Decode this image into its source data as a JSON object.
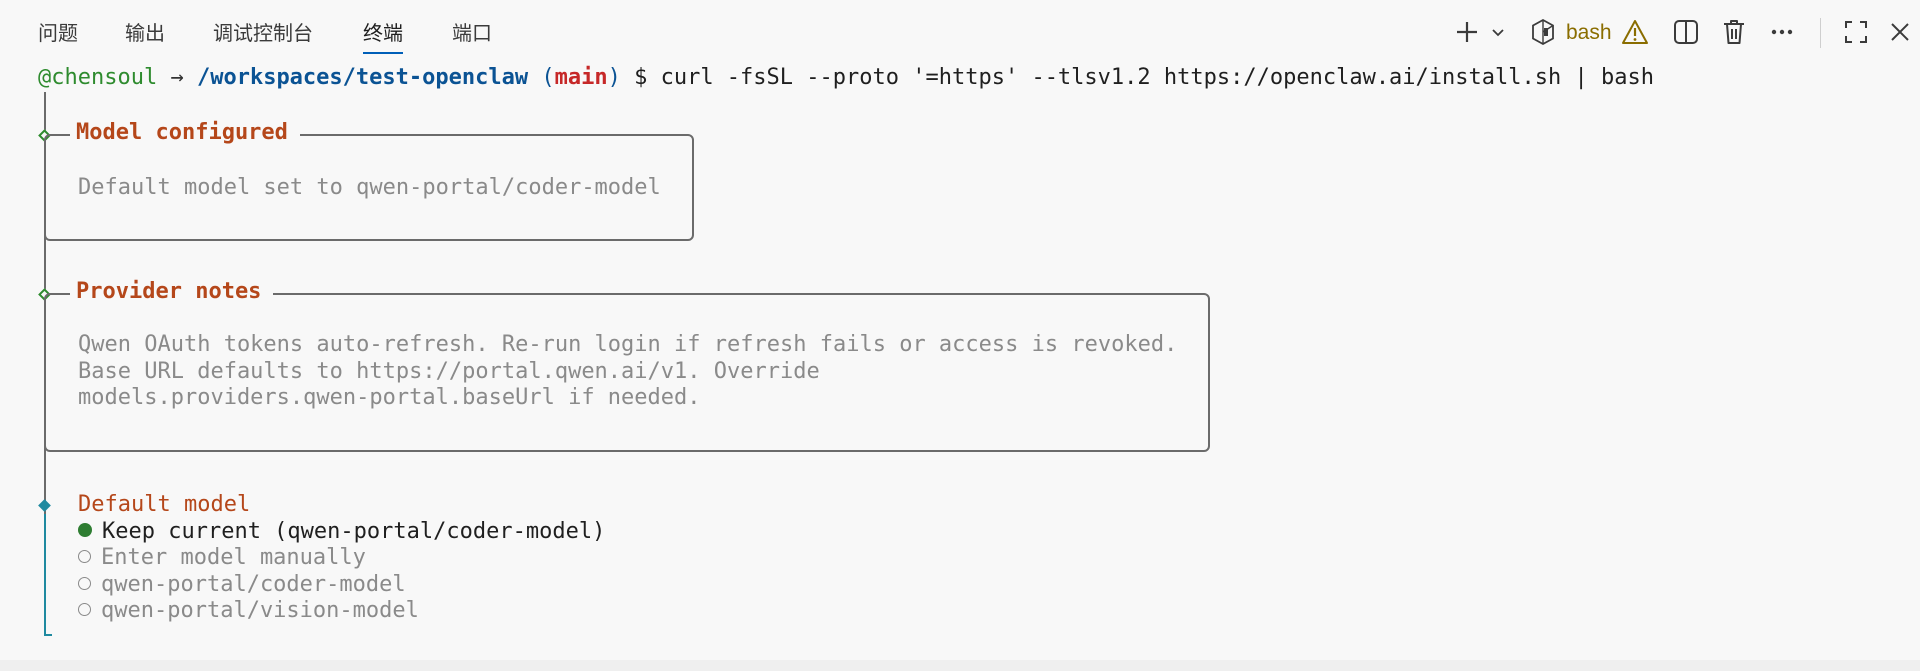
{
  "tabs": [
    {
      "label": "问题"
    },
    {
      "label": "输出"
    },
    {
      "label": "调试控制台"
    },
    {
      "label": "终端"
    },
    {
      "label": "端口"
    }
  ],
  "toolbar": {
    "shell_label": "bash",
    "icons": [
      "plus-icon",
      "chevron-down-icon",
      "terminal-shell-icon",
      "warning-icon",
      "split-icon",
      "trash-icon",
      "more-icon",
      "maximize-icon",
      "close-icon"
    ]
  },
  "prompt": {
    "user": "@chensoul",
    "arrow": " → ",
    "path": "/workspaces/test-openclaw",
    "branch_open": " (",
    "branch": "main",
    "branch_close": ")",
    "command": " $ curl -fsSL --proto '=https' --tlsv1.2 https://openclaw.ai/install.sh | bash"
  },
  "model_configured": {
    "title": "Model configured",
    "text": "Default model set to qwen-portal/coder-model"
  },
  "provider_notes": {
    "title": "Provider notes",
    "lines": [
      "Qwen OAuth tokens auto-refresh. Re-run login if refresh fails or access is revoked.",
      "Base URL defaults to https://portal.qwen.ai/v1. Override",
      "models.providers.qwen-portal.baseUrl if needed."
    ]
  },
  "default_model": {
    "title": "Default model",
    "options": [
      {
        "label": "Keep current (qwen-portal/coder-model)",
        "selected": true
      },
      {
        "label": "Enter model manually",
        "selected": false
      },
      {
        "label": "qwen-portal/coder-model",
        "selected": false
      },
      {
        "label": "qwen-portal/vision-model",
        "selected": false
      }
    ]
  },
  "colors": {
    "accent": "#005fb8",
    "title_orange": "#b5471a",
    "teal": "#1f8aa0",
    "green": "#2e7d32"
  }
}
